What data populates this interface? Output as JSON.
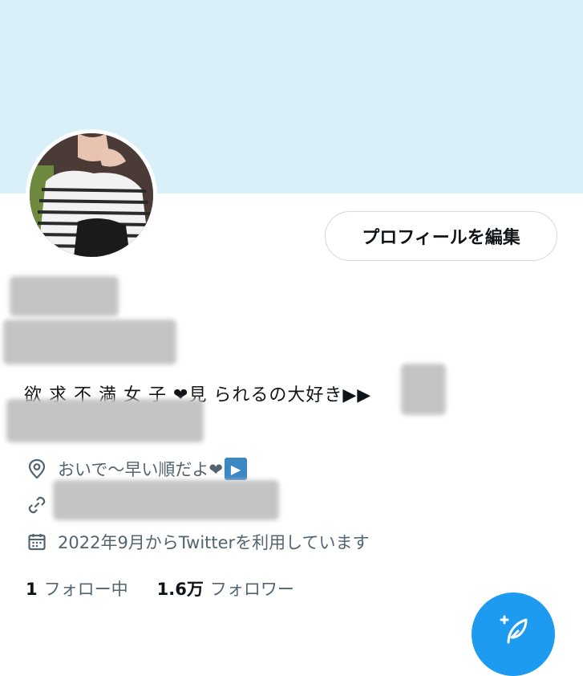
{
  "profile": {
    "edit_button_label": "プロフィールを編集",
    "bio_line1": "欲 求 不 満 女 子 ❤見 られるの大好き▶▶",
    "location_text": "おいで〜早い順だよ❤",
    "location_badge": "▶",
    "join_date_text": "2022年9月からTwitterを利用しています"
  },
  "stats": {
    "following_count": "1",
    "following_label": "フォロー中",
    "followers_count": "1.6万",
    "followers_label": "フォロワー"
  },
  "icons": {
    "location": "location-pin-icon",
    "link": "link-icon",
    "calendar": "calendar-icon",
    "compose": "compose-tweet-icon"
  },
  "colors": {
    "banner": "#d9f0f8",
    "accent": "#1d9bf0",
    "secondary_text": "#536471"
  }
}
